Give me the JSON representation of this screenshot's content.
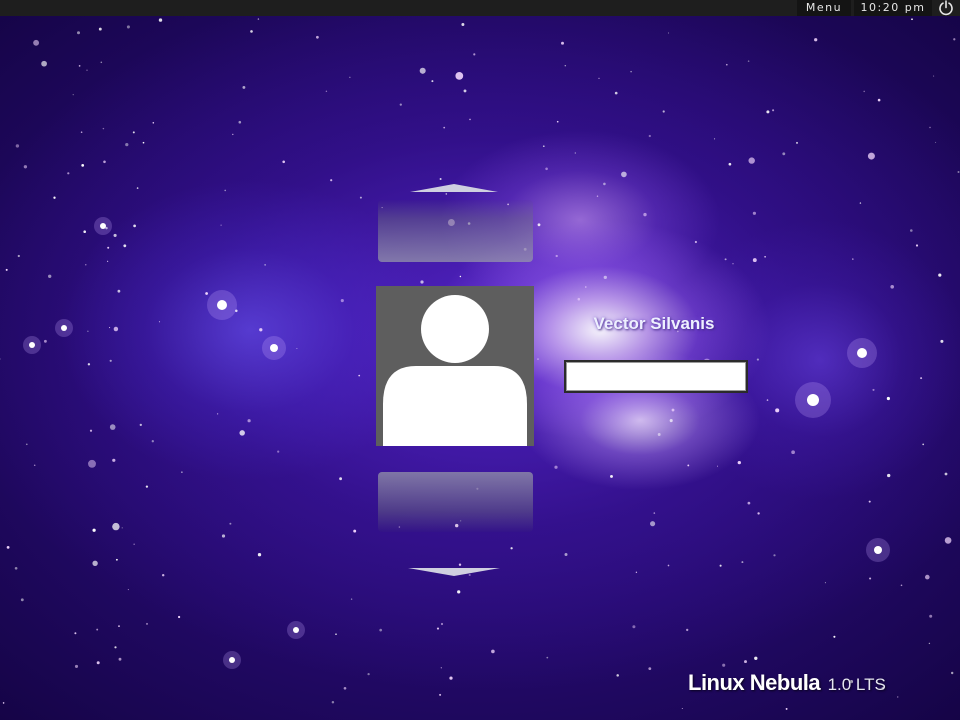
{
  "top_panel": {
    "menu_label": "Menu",
    "clock": "10:20 pm",
    "power_icon": "power-icon"
  },
  "login": {
    "username": "Vector Silvanis",
    "password_value": "",
    "avatar_icon": "user-silhouette-icon",
    "scroll_up_icon": "chevron-up-icon",
    "scroll_down_icon": "chevron-down-icon"
  },
  "branding": {
    "name": "Linux Nebula",
    "version": "1.0 LTS"
  },
  "colors": {
    "background_accent": "#3a159a",
    "panel": "#1e1e1e",
    "avatar_bg": "#5e5e5e"
  }
}
